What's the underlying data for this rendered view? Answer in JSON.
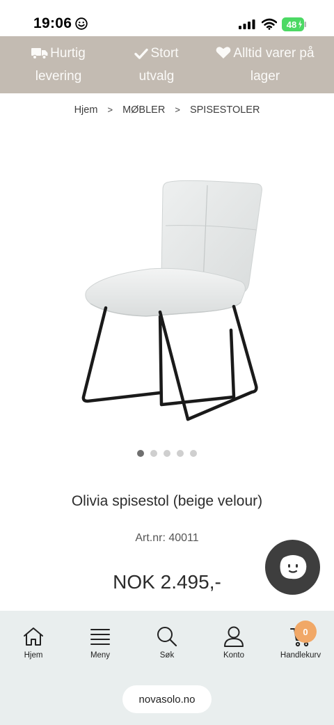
{
  "status_bar": {
    "time": "19:06",
    "battery": "48"
  },
  "promo": [
    {
      "icon": "truck-icon",
      "line1": "Hurtig",
      "line2": "levering"
    },
    {
      "icon": "check-icon",
      "line1": "Stort",
      "line2": "utvalg"
    },
    {
      "icon": "heart-icon",
      "line1": "Alltid varer på",
      "line2": "lager"
    }
  ],
  "breadcrumb": {
    "items": [
      "Hjem",
      "MØBLER",
      "SPISESTOLER"
    ],
    "separator": ">"
  },
  "carousel": {
    "count": 5,
    "active": 1
  },
  "product": {
    "title": "Olivia spisestol (beige velour)",
    "art_nr": "Art.nr: 40011",
    "price": "NOK 2.495,-"
  },
  "nav": {
    "items": [
      {
        "label": "Hjem",
        "icon": "home-icon"
      },
      {
        "label": "Meny",
        "icon": "menu-icon"
      },
      {
        "label": "Søk",
        "icon": "search-icon"
      },
      {
        "label": "Konto",
        "icon": "user-icon"
      },
      {
        "label": "Handlekurv",
        "icon": "cart-icon"
      }
    ],
    "cart_count": "0"
  },
  "browser": {
    "url": "novasolo.no"
  },
  "colors": {
    "promo_bg": "#c3bbb2",
    "nav_bg": "#e9eeee",
    "badge": "#f1a867",
    "battery_green": "#4cd964",
    "chat_bg": "#3e3e3e"
  }
}
